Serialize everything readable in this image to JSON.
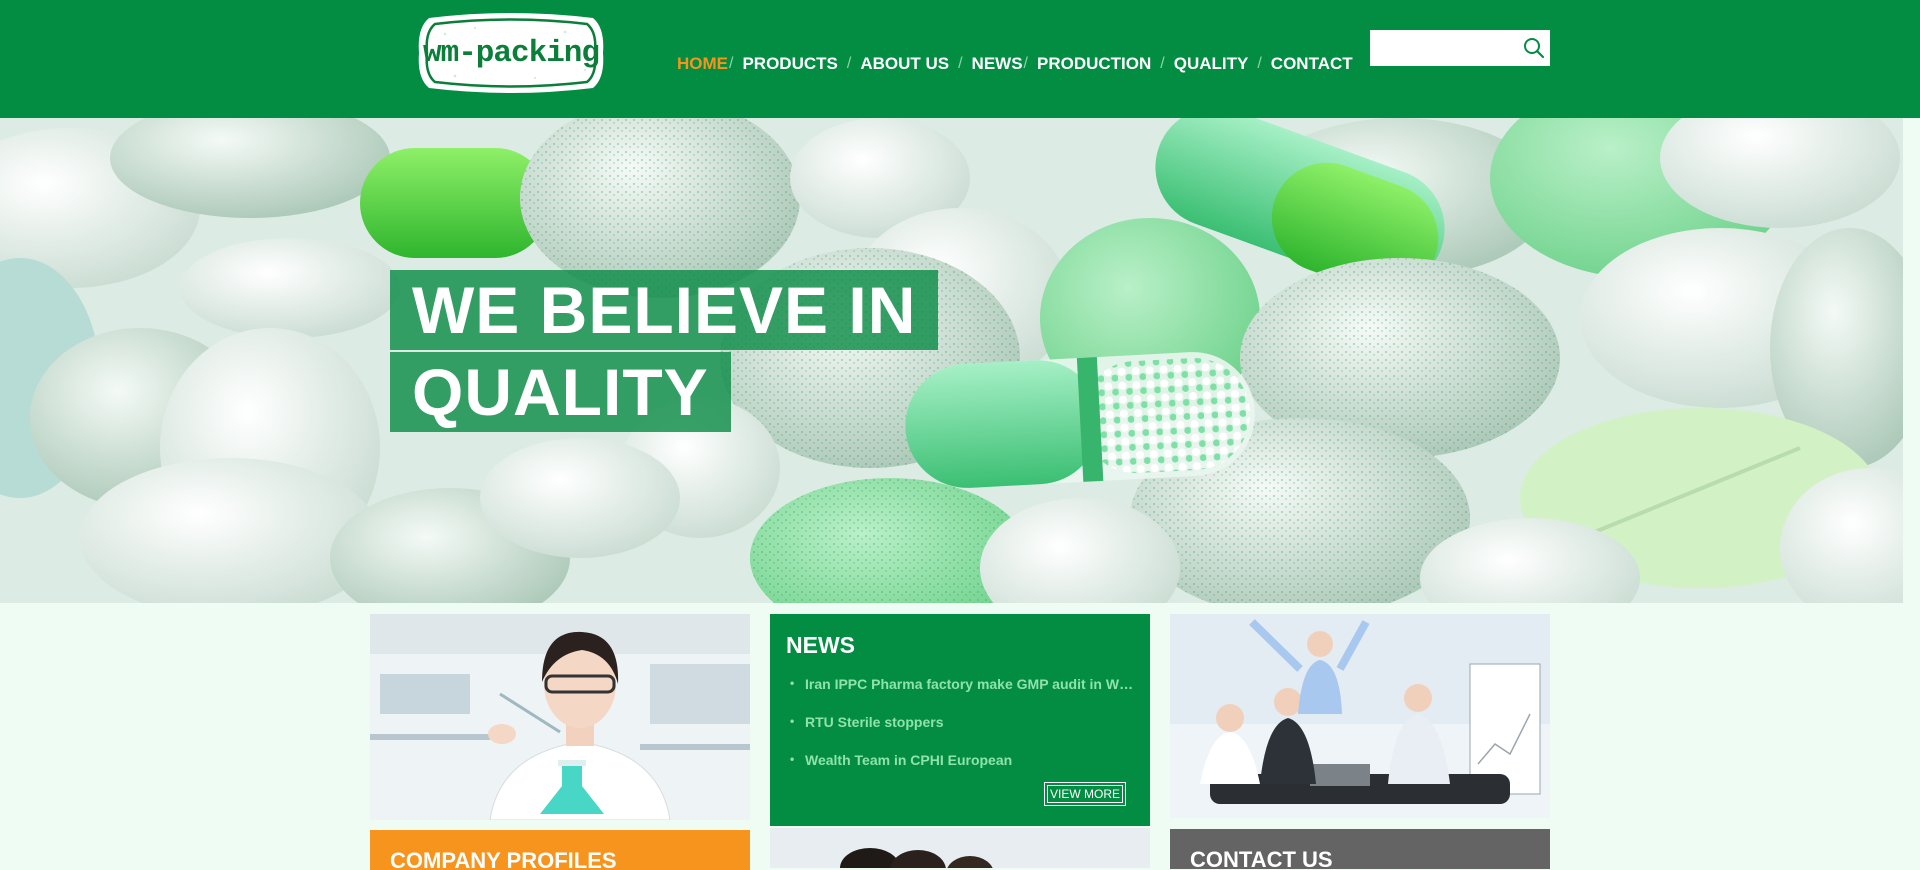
{
  "brand": {
    "logo_text": "wm-packing",
    "logo_icon": "wm-packing-logo",
    "green": "#038d43",
    "orange": "#f7941d"
  },
  "nav": {
    "items": [
      {
        "label": "HOME",
        "active": true
      },
      {
        "label": "PRODUCTS"
      },
      {
        "label": "ABOUT US"
      },
      {
        "label": "NEWS"
      },
      {
        "label": "PRODUCTION"
      },
      {
        "label": "QUALITY"
      },
      {
        "label": "CONTACT"
      }
    ],
    "separator": "/"
  },
  "search": {
    "value": "",
    "placeholder": "",
    "icon": "search-icon"
  },
  "hero": {
    "line1": "WE BELIEVE IN",
    "line2": "QUALITY",
    "image": "green-white-pills-photo"
  },
  "news": {
    "title": "NEWS",
    "items": [
      "Iran IPPC Pharma factory make GMP audit in WM-packing",
      "RTU Sterile stoppers",
      "Wealth Team in CPHI European"
    ],
    "view_more": "VIEW MORE"
  },
  "sections": {
    "company_profiles": "COMPANY PROFILES",
    "contact_us": "CONTACT US"
  },
  "images": {
    "lab": "scientist-with-flask-photo",
    "team": "celebrating-business-team-photo",
    "middle": "people-photo"
  }
}
